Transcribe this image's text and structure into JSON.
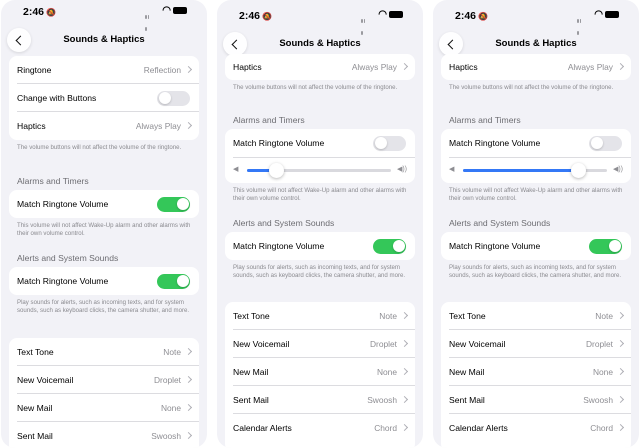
{
  "screens": [
    {
      "status": {
        "time": "2:46"
      },
      "nav": {
        "title": "Sounds & Haptics"
      },
      "top_group": {
        "ringtone": {
          "label": "Ringtone",
          "value": "Reflection"
        },
        "change_with_buttons": {
          "label": "Change with Buttons",
          "on": false
        },
        "haptics": {
          "label": "Haptics",
          "value": "Always Play"
        }
      },
      "ringtone_note": "The volume buttons will not affect the volume of the ringtone.",
      "alarms": {
        "header": "Alarms and Timers",
        "match_label": "Match Ringtone Volume",
        "match_on": true,
        "note": "This volume will not affect Wake-Up alarm and other alarms with their own volume control."
      },
      "alerts": {
        "header": "Alerts and System Sounds",
        "match_label": "Match Ringtone Volume",
        "match_on": true,
        "note": "Play sounds for alerts, such as incoming texts, and for system sounds, such as keyboard clicks, the camera shutter, and more."
      },
      "tones": [
        {
          "label": "Text Tone",
          "value": "Note"
        },
        {
          "label": "New Voicemail",
          "value": "Droplet"
        },
        {
          "label": "New Mail",
          "value": "None"
        },
        {
          "label": "Sent Mail",
          "value": "Swoosh"
        }
      ]
    },
    {
      "status": {
        "time": "2:46"
      },
      "nav": {
        "title": "Sounds & Haptics"
      },
      "haptics_row": {
        "label": "Haptics",
        "value": "Always Play"
      },
      "ringtone_note": "The volume buttons will not affect the volume of the ringtone.",
      "alarms": {
        "header": "Alarms and Timers",
        "match_label": "Match Ringtone Volume",
        "match_on": false,
        "volume_fraction": 0.2,
        "note": "This volume will not affect Wake-Up alarm and other alarms with their own volume control."
      },
      "alerts": {
        "header": "Alerts and System Sounds",
        "match_label": "Match Ringtone Volume",
        "match_on": true,
        "note": "Play sounds for alerts, such as incoming texts, and for system sounds, such as keyboard clicks, the camera shutter, and more."
      },
      "tones": [
        {
          "label": "Text Tone",
          "value": "Note"
        },
        {
          "label": "New Voicemail",
          "value": "Droplet"
        },
        {
          "label": "New Mail",
          "value": "None"
        },
        {
          "label": "Sent Mail",
          "value": "Swoosh"
        },
        {
          "label": "Calendar Alerts",
          "value": "Chord"
        }
      ]
    },
    {
      "status": {
        "time": "2:46"
      },
      "nav": {
        "title": "Sounds & Haptics"
      },
      "haptics_row": {
        "label": "Haptics",
        "value": "Always Play"
      },
      "ringtone_note": "The volume buttons will not affect the volume of the ringtone.",
      "alarms": {
        "header": "Alarms and Timers",
        "match_label": "Match Ringtone Volume",
        "match_on": false,
        "volume_fraction": 0.8,
        "note": "This volume will not affect Wake-Up alarm and other alarms with their own volume control."
      },
      "alerts": {
        "header": "Alerts and System Sounds",
        "match_label": "Match Ringtone Volume",
        "match_on": true,
        "note": "Play sounds for alerts, such as incoming texts, and for system sounds, such as keyboard clicks, the camera shutter, and more."
      },
      "tones": [
        {
          "label": "Text Tone",
          "value": "Note"
        },
        {
          "label": "New Voicemail",
          "value": "Droplet"
        },
        {
          "label": "New Mail",
          "value": "None"
        },
        {
          "label": "Sent Mail",
          "value": "Swoosh"
        },
        {
          "label": "Calendar Alerts",
          "value": "Chord"
        }
      ]
    }
  ],
  "colors": {
    "toggle_on": "#34c759",
    "toggle_off": "#e4e4e9",
    "slider_fill": "#3478f6",
    "background": "#f2f2f7"
  },
  "icons": [
    "chevron-left-icon",
    "chevron-right-icon",
    "wifi-icon",
    "battery-icon",
    "cellular-signal-icon",
    "silent-bell-icon",
    "speaker-low-icon",
    "speaker-high-icon"
  ]
}
